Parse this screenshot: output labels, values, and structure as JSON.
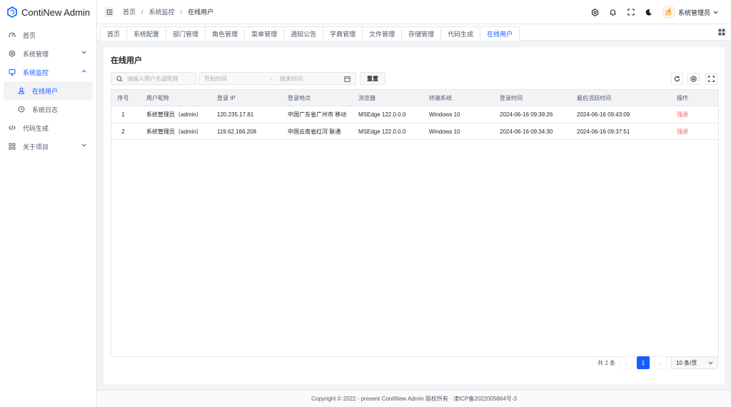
{
  "app": {
    "title": "ContiNew Admin",
    "brand_color": "#165dff"
  },
  "sidebar": {
    "items": [
      {
        "label": "首页",
        "icon": "dashboard-icon"
      },
      {
        "label": "系统管理",
        "icon": "settings-icon"
      },
      {
        "label": "系统监控",
        "icon": "monitor-icon",
        "expanded": true
      },
      {
        "label": "在线用户",
        "icon": "user-icon",
        "active": true
      },
      {
        "label": "系统日志",
        "icon": "history-icon"
      },
      {
        "label": "代码生成",
        "icon": "code-icon"
      },
      {
        "label": "关于项目",
        "icon": "apps-icon"
      }
    ]
  },
  "header": {
    "breadcrumb": [
      "首页",
      "系统监控",
      "在线用户"
    ],
    "separator": "/",
    "user_name": "系统管理员"
  },
  "tabs": [
    {
      "label": "首页"
    },
    {
      "label": "系统配置"
    },
    {
      "label": "部门管理"
    },
    {
      "label": "角色管理"
    },
    {
      "label": "菜单管理"
    },
    {
      "label": "通知公告"
    },
    {
      "label": "字典管理"
    },
    {
      "label": "文件管理"
    },
    {
      "label": "存储管理"
    },
    {
      "label": "代码生成"
    },
    {
      "label": "在线用户",
      "active": true
    }
  ],
  "main": {
    "title": "在线用户",
    "search_placeholder": "请输入用户名或昵称",
    "date_start_placeholder": "开始时间",
    "date_sep": "-",
    "date_end_placeholder": "结束时间",
    "reset_label": "重置",
    "columns": [
      "序号",
      "用户昵称",
      "登录 IP",
      "登录地点",
      "浏览器",
      "终端系统",
      "登录时间",
      "最后活跃时间",
      "操作"
    ],
    "rows": [
      [
        "1",
        "系统管理员（admin）",
        "120.235.17.81",
        "中国广东省广州市 移动",
        "MSEdge 122.0.0.0",
        "Windows 10",
        "2024-06-16 09:39:26",
        "2024-06-16 09:43:09",
        "强退"
      ],
      [
        "2",
        "系统管理员（admin）",
        "119.62.166.208",
        "中国云南省红河 联通",
        "MSEdge 122.0.0.0",
        "Windows 10",
        "2024-06-16 09:34:30",
        "2024-06-16 09:37:51",
        "强退"
      ]
    ]
  },
  "pagination": {
    "total_text": "共 2 条",
    "prev": "‹",
    "current_page": "1",
    "next": "›",
    "page_size": "10 条/页"
  },
  "footer": {
    "text": "Copyright © 2022 - present ContiNew Admin 版权所有 · 津ICP备2022005864号-3"
  }
}
